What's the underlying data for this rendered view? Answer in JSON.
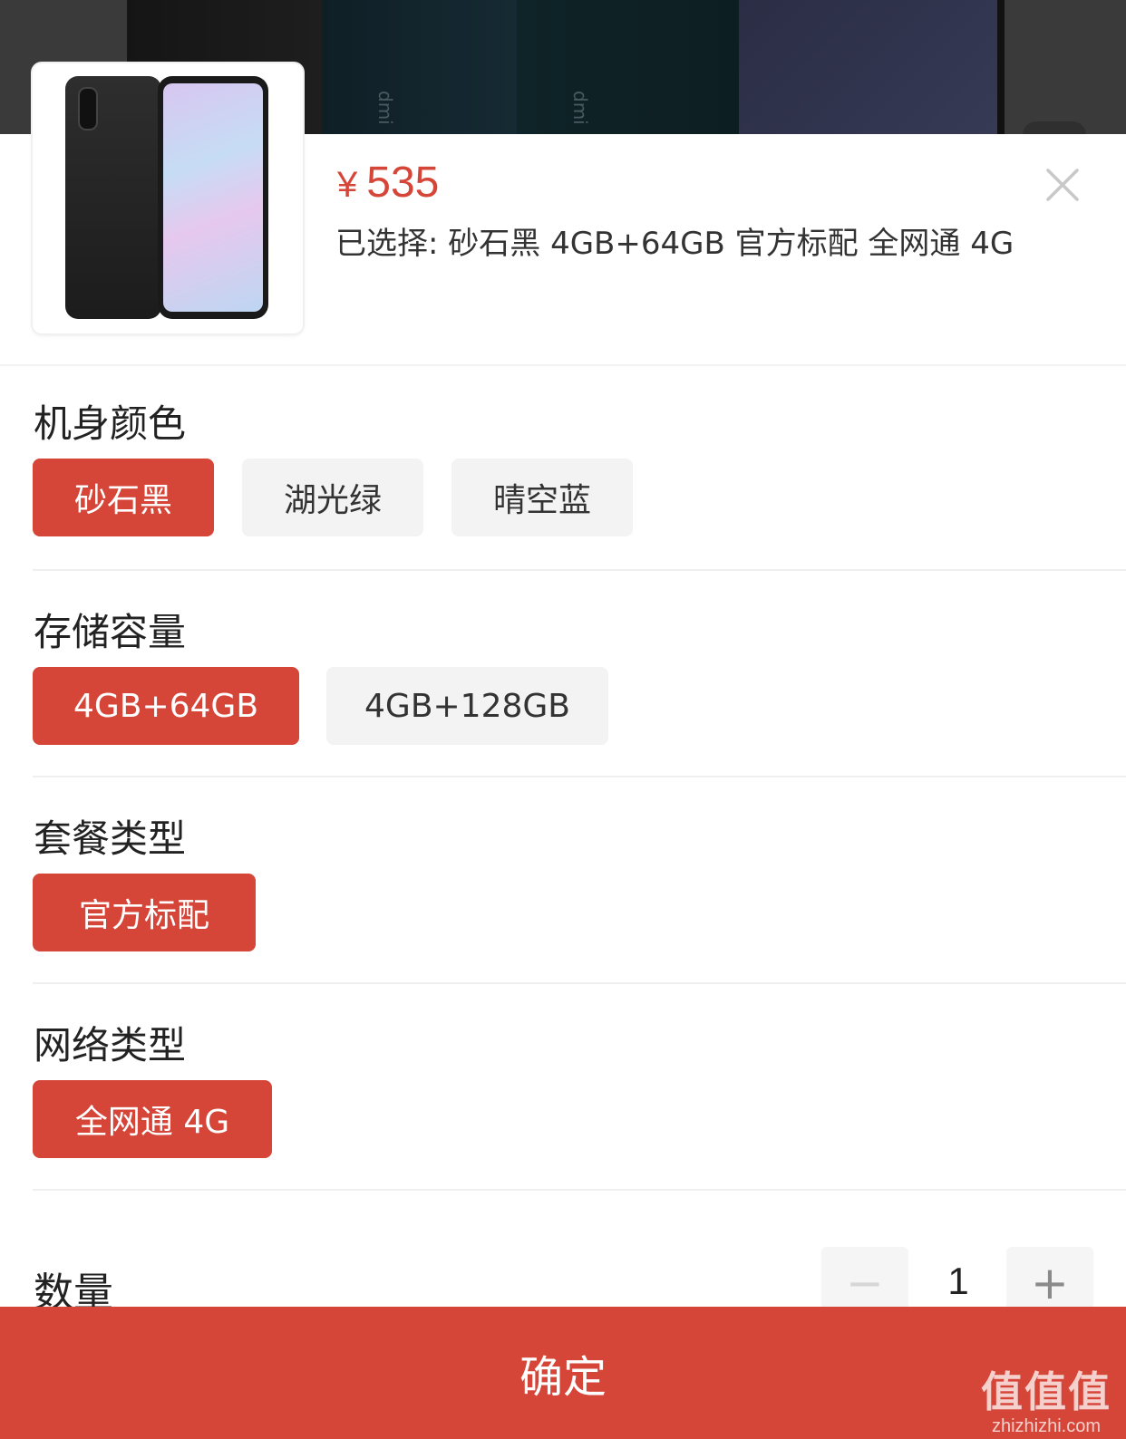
{
  "product": {
    "price_symbol": "¥",
    "price_value": "535",
    "selected_text": "已选择: 砂石黑 4GB+64GB 官方标配 全网通 4G"
  },
  "backdrop_labels": [
    "dmi",
    "dmi"
  ],
  "specs": {
    "color": {
      "title": "机身颜色",
      "options": [
        "砂石黑",
        "湖光绿",
        "晴空蓝"
      ],
      "selected": "砂石黑"
    },
    "storage": {
      "title": "存储容量",
      "options": [
        "4GB+64GB",
        "4GB+128GB"
      ],
      "selected": "4GB+64GB"
    },
    "bundle": {
      "title": "套餐类型",
      "options": [
        "官方标配"
      ],
      "selected": "官方标配"
    },
    "network": {
      "title": "网络类型",
      "options": [
        "全网通 4G"
      ],
      "selected": "全网通 4G"
    }
  },
  "quantity": {
    "label": "数量",
    "value": "1",
    "minus_symbol": "−",
    "plus_symbol": "+"
  },
  "confirm_label": "确定",
  "watermark": {
    "big": "值值值",
    "small": "zhizhizhi.com"
  },
  "colors": {
    "accent": "#d54538",
    "chip_off": "#f3f3f3"
  }
}
